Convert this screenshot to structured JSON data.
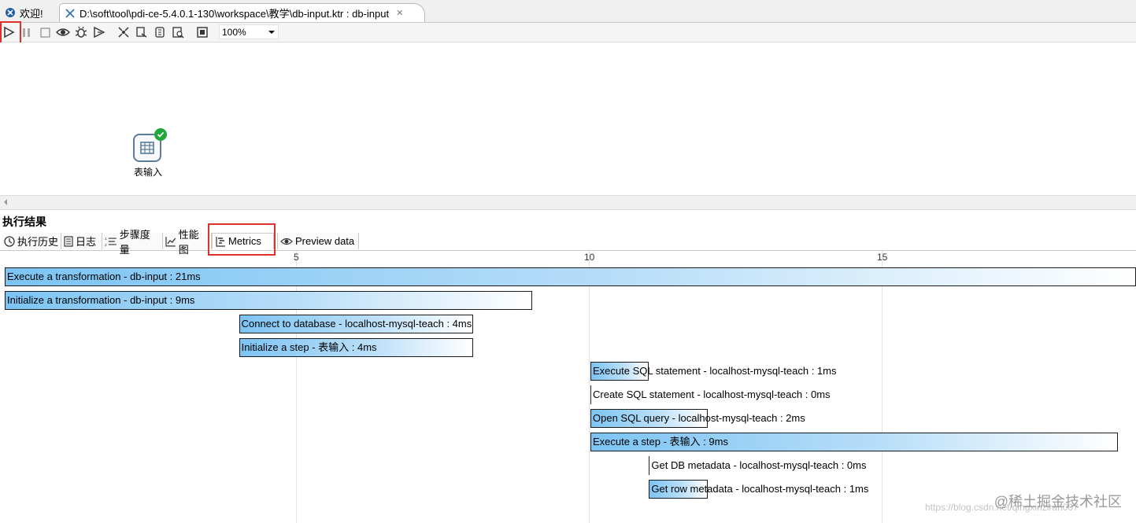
{
  "tabs": [
    {
      "label": "欢迎!"
    },
    {
      "label": "D:\\soft\\tool\\pdi-ce-5.4.0.1-130\\workspace\\教学\\db-input.ktr : db-input"
    }
  ],
  "toolbar": {
    "zoom": "100%"
  },
  "canvas": {
    "step_label": "表输入"
  },
  "results": {
    "title": "执行结果",
    "tabs": [
      "执行历史",
      "日志",
      "步骤度量",
      "性能图",
      "Metrics",
      "Preview data"
    ],
    "selected_tab": "Metrics"
  },
  "timeline": {
    "ticks": [
      "5",
      "10",
      "15"
    ],
    "rows": [
      {
        "label": "Execute a transformation - db-input : 21ms",
        "start": 0.0,
        "duration": 21
      },
      {
        "label": "Initialize a transformation - db-input : 9ms",
        "start": 0.0,
        "duration": 9
      },
      {
        "label": "Connect to database - localhost-mysql-teach : 4ms",
        "start": 4.0,
        "duration": 4
      },
      {
        "label": "Initialize a step - 表输入 : 4ms",
        "start": 4.0,
        "duration": 4
      },
      {
        "label": "Execute SQL statement - localhost-mysql-teach : 1ms",
        "start": 10.0,
        "duration": 1
      },
      {
        "label": "Create SQL statement - localhost-mysql-teach : 0ms",
        "start": 10.0,
        "duration": 0
      },
      {
        "label": "Open SQL query - localhost-mysql-teach : 2ms",
        "start": 10.0,
        "duration": 2
      },
      {
        "label": "Execute a step - 表输入 : 9ms",
        "start": 10.0,
        "duration": 9
      },
      {
        "label": "Get DB metadata - localhost-mysql-teach : 0ms",
        "start": 11.0,
        "duration": 0
      },
      {
        "label": "Get row metadata - localhost-mysql-teach : 1ms",
        "start": 11.0,
        "duration": 1
      }
    ]
  },
  "watermark": "@稀土掘金技术社区",
  "watermark_url": "https://blog.csdn.net/qingxinziran007"
}
